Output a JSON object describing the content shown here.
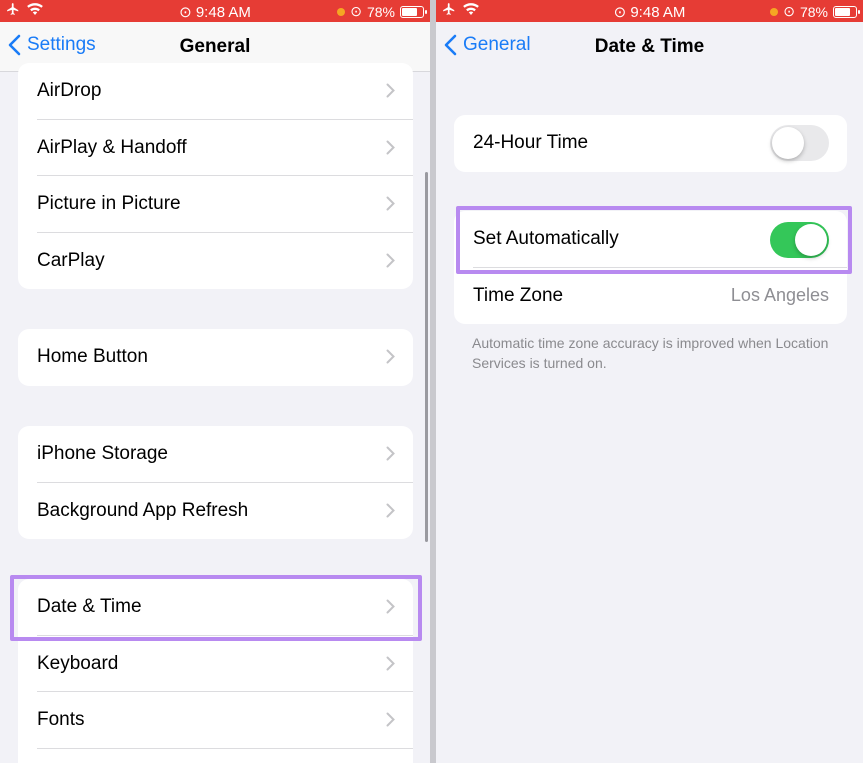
{
  "colors": {
    "status_bar": "#e63c35",
    "accent": "#1a7cf7",
    "toggle_on": "#34c759",
    "toggle_off": "#e9e9eb",
    "highlight": "#b88af0"
  },
  "status_bar": {
    "time": "9:48 AM",
    "battery": "78%"
  },
  "left_screen": {
    "navbar": {
      "back_label": "Settings",
      "title": "General"
    },
    "groups": [
      [
        {
          "label": "AirDrop"
        },
        {
          "label": "AirPlay & Handoff"
        },
        {
          "label": "Picture in Picture"
        },
        {
          "label": "CarPlay"
        }
      ],
      [
        {
          "label": "Home Button"
        }
      ],
      [
        {
          "label": "iPhone Storage"
        },
        {
          "label": "Background App Refresh"
        }
      ],
      [
        {
          "label": "Date & Time"
        },
        {
          "label": "Keyboard"
        },
        {
          "label": "Fonts"
        }
      ]
    ]
  },
  "right_screen": {
    "navbar": {
      "back_label": "General",
      "title": "Date & Time"
    },
    "hour24": {
      "label": "24-Hour Time",
      "on": false
    },
    "set_automatically": {
      "label": "Set Automatically",
      "on": true
    },
    "time_zone": {
      "label": "Time Zone",
      "value": "Los Angeles"
    },
    "footnote": "Automatic time zone accuracy is improved when Location Services is turned on."
  }
}
